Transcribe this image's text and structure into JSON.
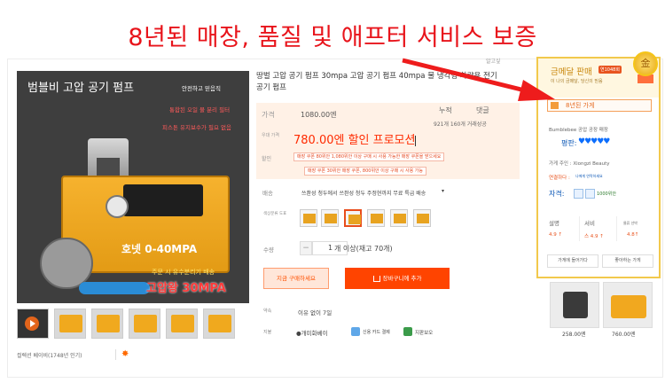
{
  "caption": "8년된 매장, 품질 및 애프터 서비스 보증",
  "report_link": "알고싶",
  "main_image": {
    "title": "범블비 고압 공기 펌프",
    "note_1": "안전하고 믿음직",
    "note_2": "통합된 오일 물 분리 필터",
    "note_3": "피스톤 유지보수가 필요 없음",
    "model_label": "호넷 0-40MPA",
    "sub_promo": "주문 시 유수분리기 배송",
    "pressure_label": "고압왕 30MPA"
  },
  "collect_text": "컬렉션 베이비(1748년 인기)",
  "product": {
    "title": "땅벌 고압 공기 펌프 30mpa 고압 공기 펌프 40mpa 물 냉각형 차량용 전기",
    "title_line2": "공기 펌프",
    "price_label": "가격",
    "original_price": "1080.00엔",
    "stat_sales_head": "누적",
    "stat_sales_value": "921개 160개 거래성공",
    "stat_review_head": "댓글",
    "promo_label": "우대 가격",
    "promo_price": "780.00엔 할인 프로모션",
    "coupon_label": "할인",
    "coupon_1": "매장 쿠폰 80위안 1,080위안 이상 구매 시 사용 가능한 매장 쿠폰을 받으세요",
    "coupon_2": "매장 쿠폰 30위안 매장 쿠폰, 800위안 이상 구매 시 사용 가능",
    "shipping_label": "배송",
    "shipping_text": "쓰촨성 청두에서 쓰촨성 청두 주정현까지 무료 특급 배송",
    "option_label": "색상분류 도표",
    "qty_label": "수량",
    "qty_value": "1",
    "qty_stock": "개 이상(재고 70개)",
    "buy_now": "지금 구매하세요",
    "add_cart": "장바구니에 추가",
    "return_label": "약속",
    "return_text": "이유 없이 7일",
    "payment_label": "지불",
    "pay_1": "●개미화베이",
    "pay_2": "신용 카드 결제",
    "pay_3": "지판보오"
  },
  "shop": {
    "gold_title": "금메달 판매",
    "gold_badge": "연1048회",
    "gold_sub": "이 나의 금메달, 당신의 믿음",
    "medal": "金",
    "years_tag": "8년된 가게",
    "shop_name": "Bumblebee 공압 공장 매장",
    "rating_label": "평판:",
    "rating_hearts": "♥♥♥♥♥",
    "keeper": "가게 주인 : Xiongzi Beauty",
    "contact_label": "연결하다 :",
    "contact_text": "나에게 연락하세요",
    "qual_label": "자격:",
    "qual_text": "1000위안",
    "m1_head": "설명",
    "m1_val": "4.9 ↑",
    "m2_head": "서비",
    "m2_val": "스 4.9 ↑",
    "m3_head": "물류 선박",
    "m3_val": "4.8↑",
    "btn_enter": "가게에 들어가다",
    "btn_fav": "좋아하는 가게"
  },
  "recommendations": [
    {
      "price": "258.00엔"
    },
    {
      "price": "760.00엔"
    }
  ]
}
